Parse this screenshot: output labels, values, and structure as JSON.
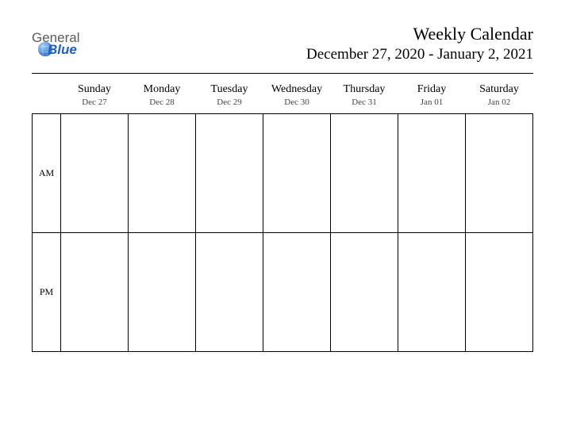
{
  "logo": {
    "top": "General",
    "bottom": "Blue"
  },
  "header": {
    "title": "Weekly Calendar",
    "subtitle": "December 27, 2020 - January 2, 2021"
  },
  "rows": {
    "am": "AM",
    "pm": "PM"
  },
  "days": [
    {
      "name": "Sunday",
      "date": "Dec 27"
    },
    {
      "name": "Monday",
      "date": "Dec 28"
    },
    {
      "name": "Tuesday",
      "date": "Dec 29"
    },
    {
      "name": "Wednesday",
      "date": "Dec 30"
    },
    {
      "name": "Thursday",
      "date": "Dec 31"
    },
    {
      "name": "Friday",
      "date": "Jan 01"
    },
    {
      "name": "Saturday",
      "date": "Jan 02"
    }
  ]
}
